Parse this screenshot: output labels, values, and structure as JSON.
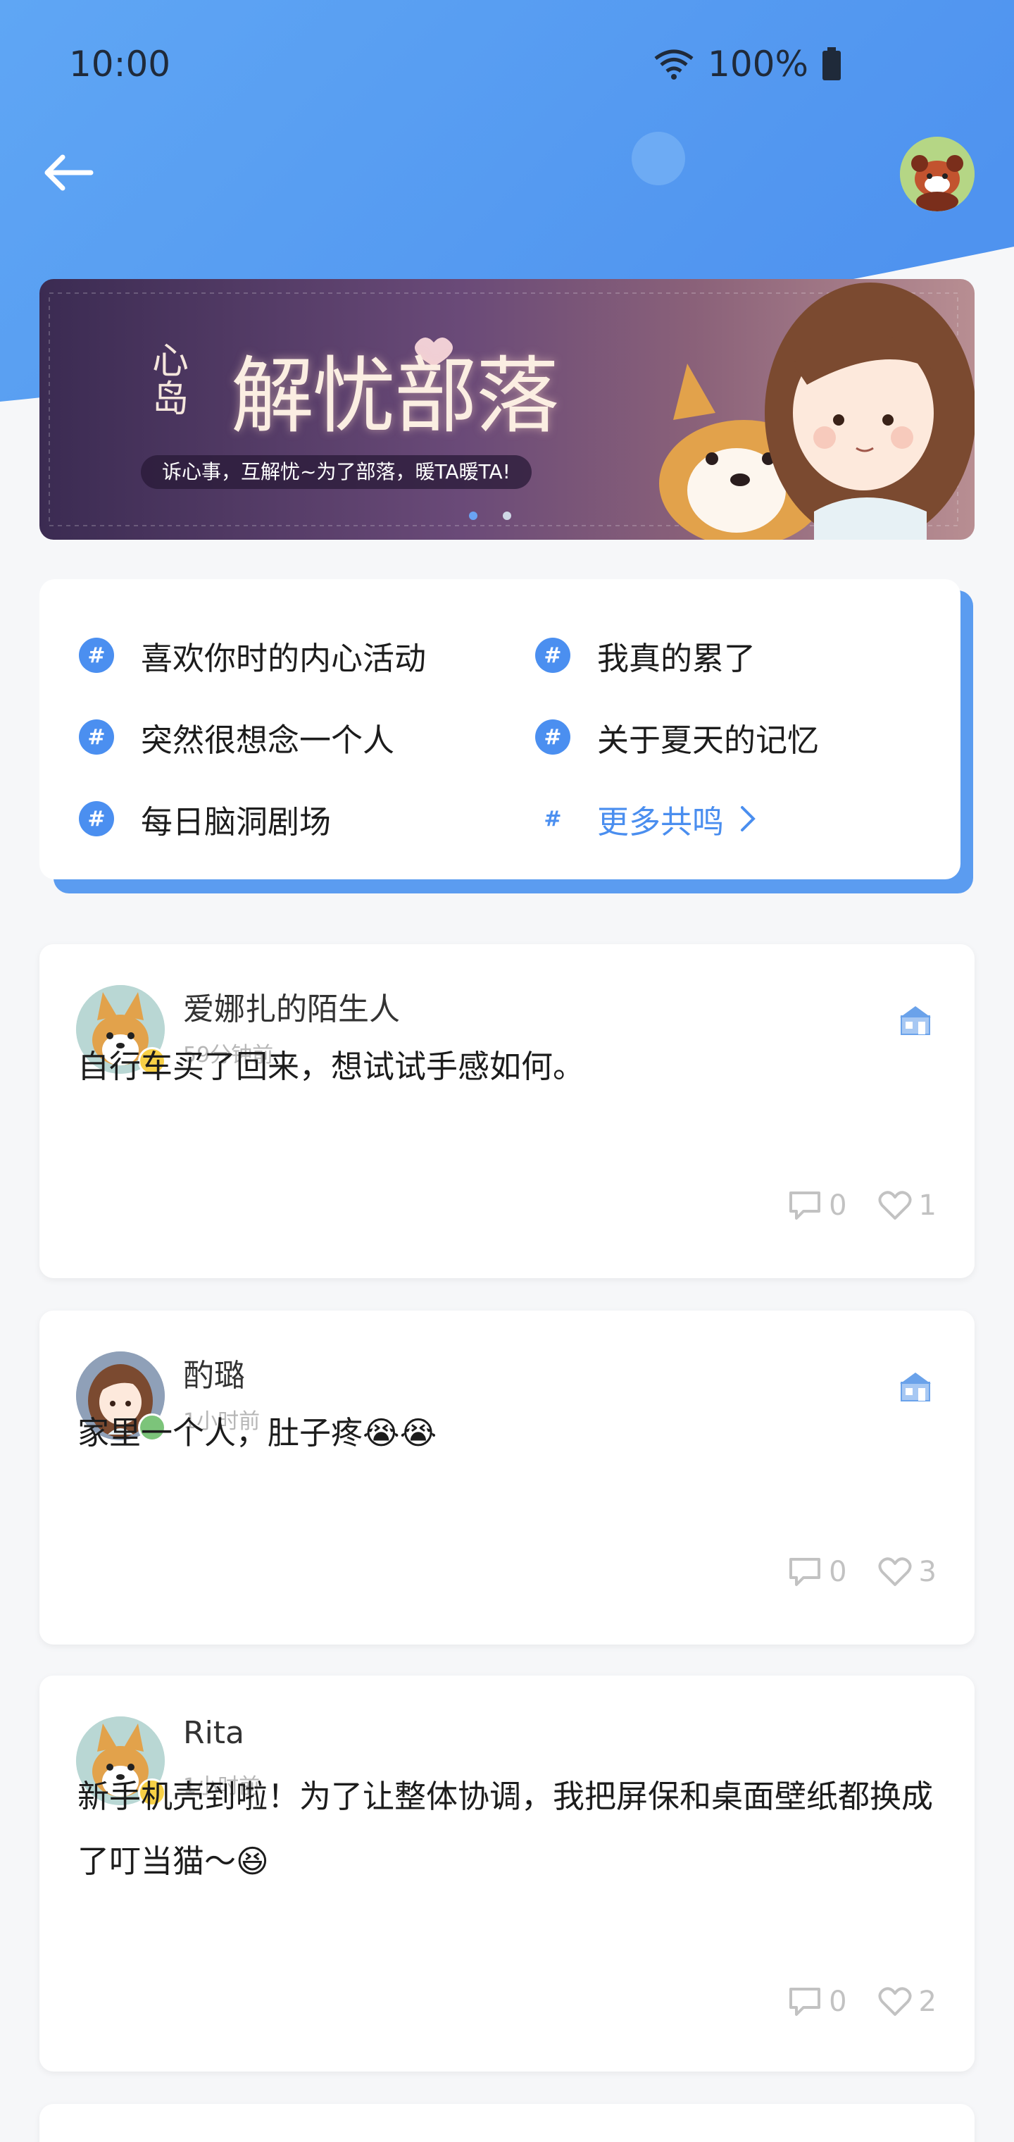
{
  "status_bar": {
    "time": "10:00",
    "battery": "100%"
  },
  "banner": {
    "title": "解忧部落",
    "prefix": "心岛",
    "subtitle": "诉心事，互解忧~为了部落，暖TA暖TA!",
    "page_count": 2,
    "active_page": 1
  },
  "topics": [
    {
      "label": "喜欢你时的内心活动"
    },
    {
      "label": "我真的累了"
    },
    {
      "label": "突然很想念一个人"
    },
    {
      "label": "关于夏天的记忆"
    },
    {
      "label": "每日脑洞剧场"
    },
    {
      "label": "更多共鸣"
    }
  ],
  "posts": [
    {
      "author": "爱娜扎的陌生人",
      "time": "59分钟前",
      "text": "自行车买了回来，想试试手感如何。",
      "comments": "0",
      "likes": "1"
    },
    {
      "author": "酌璐",
      "time": "1小时前",
      "text": "家里一个人，肚子疼😭😭",
      "comments": "0",
      "likes": "3"
    },
    {
      "author": "Rita",
      "time": "1小时前",
      "text": "新手机壳到啦！为了让整体协调，我把屏保和桌面壁纸都换成了叮当猫～😆",
      "comments": "0",
      "likes": "2"
    }
  ],
  "colors": {
    "accent": "#4b8ff0",
    "header_blue": "#5fa2f4"
  }
}
